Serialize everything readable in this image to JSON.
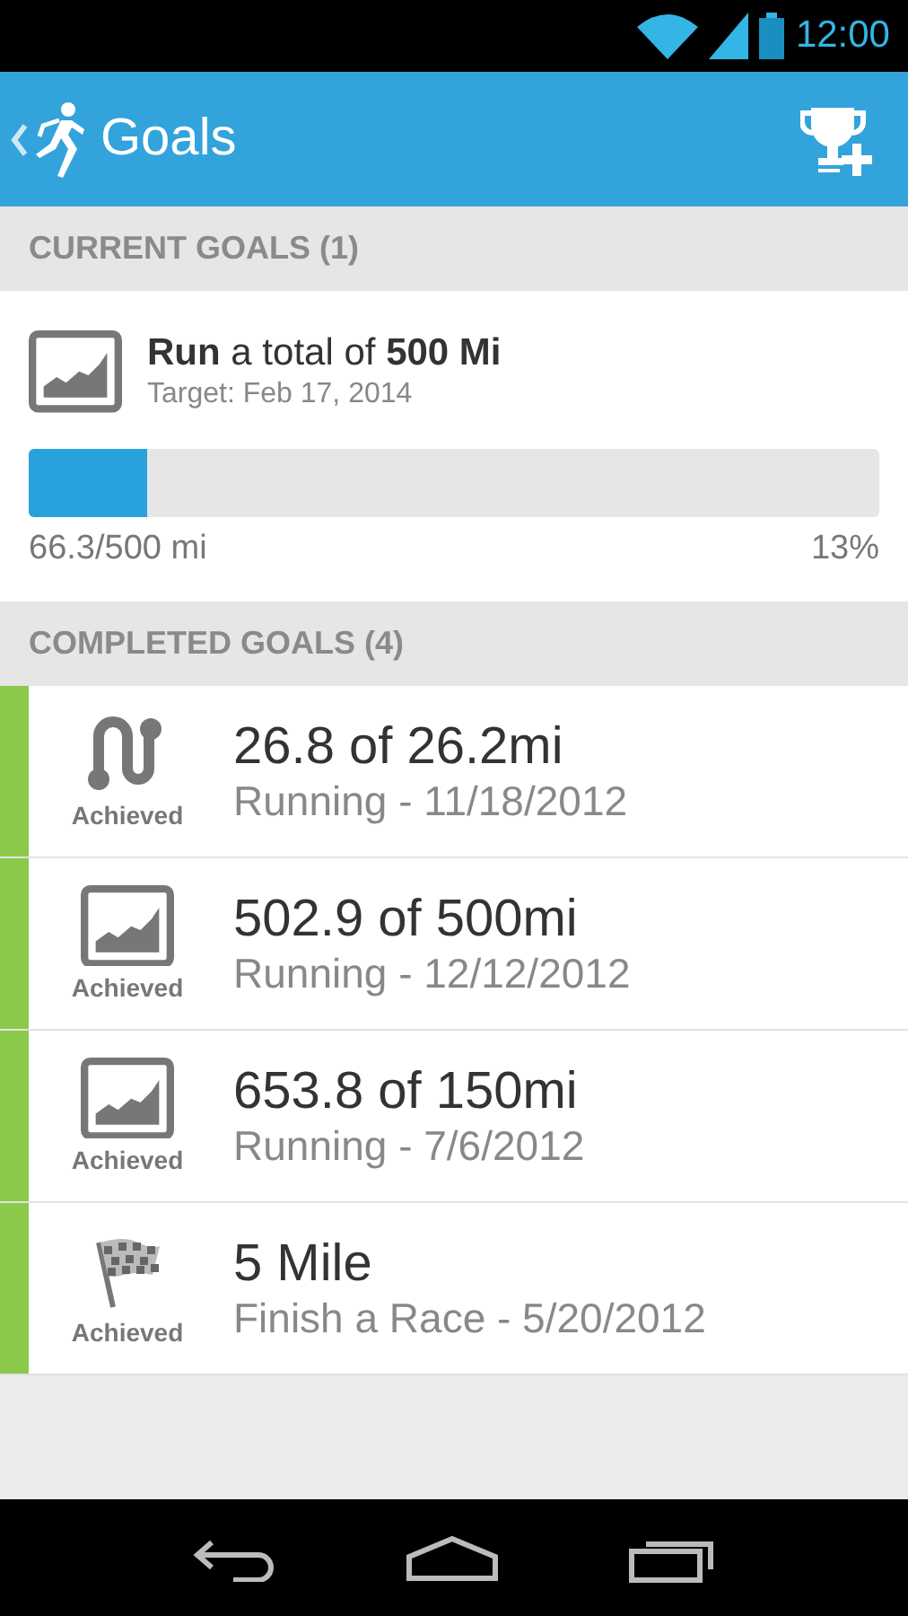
{
  "status_bar": {
    "time": "12:00"
  },
  "app_bar": {
    "title": "Goals"
  },
  "current_goals": {
    "header": "CURRENT GOALS (1)",
    "goals": [
      {
        "kind": "chart",
        "title": "**Run** a total of **500 Mi**",
        "target": "Target: Feb 17, 2014",
        "level": 0.14,
        "progress": "66.3/500 mi",
        "percent": "13%"
      }
    ]
  },
  "completed_goals": {
    "header": "COMPLETED GOALS (4)",
    "goals": [
      {
        "kind": "route",
        "status": "Achieved",
        "title": "26.8 of 26.2mi",
        "subtitle": "Running - 11/18/2012"
      },
      {
        "kind": "chart",
        "status": "Achieved",
        "title": "502.9 of 500mi",
        "subtitle": "Running - 12/12/2012"
      },
      {
        "kind": "chart",
        "status": "Achieved",
        "title": "653.8 of 150mi",
        "subtitle": "Running - 7/6/2012"
      },
      {
        "kind": "flag",
        "status": "Achieved",
        "title": "5 Mile",
        "subtitle": "Finish a Race - 5/20/2012"
      }
    ]
  }
}
